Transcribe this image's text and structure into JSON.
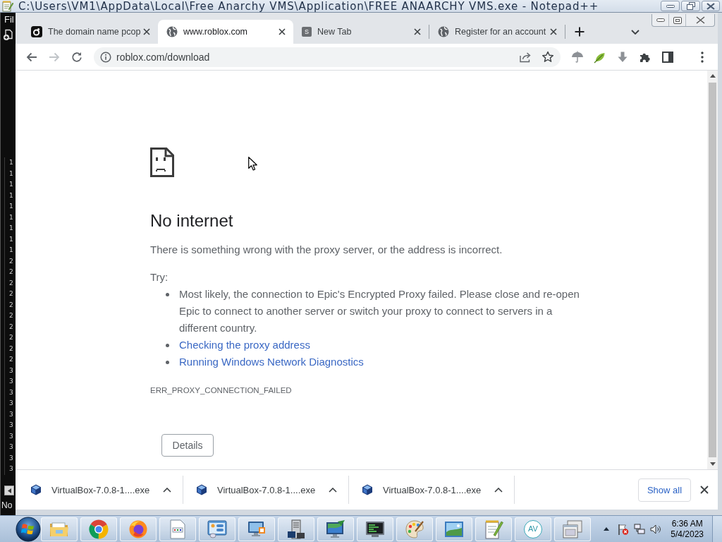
{
  "title_bar": {
    "title": "C:\\Users\\VM1\\AppData\\Local\\Free Anarchy VMS\\Application\\FREE ANAARCHY VMS.exe - Notepad++"
  },
  "editor": {
    "menu_label": "Fil",
    "line_numbers": [
      "1",
      "1",
      "1",
      "1",
      "1",
      "1",
      "1",
      "1",
      "1",
      "2",
      "2",
      "2",
      "2",
      "2",
      "2",
      "2",
      "2",
      "2",
      "2",
      "3",
      "3",
      "3",
      "3",
      "3",
      "3",
      "3",
      "3",
      "3",
      "3"
    ],
    "status_text": "No"
  },
  "browser": {
    "tabs": [
      {
        "title": "The domain name pcop",
        "favicon": {
          "kind": "logo"
        },
        "selected": false
      },
      {
        "title": "www.roblox.com",
        "favicon": {
          "kind": "globe"
        },
        "selected": true
      },
      {
        "title": "New Tab",
        "favicon": {
          "kind": "letter",
          "letter": "S"
        },
        "selected": false
      },
      {
        "title": "Register for an account",
        "favicon": {
          "kind": "globe"
        },
        "selected": false
      }
    ],
    "toolbar": {
      "back": {
        "disabled": false
      },
      "forward": {
        "disabled": true
      },
      "address": "roblox.com/download"
    },
    "page": {
      "heading": "No internet",
      "message": "There is something wrong with the proxy server, or the address is incorrect.",
      "try_label": "Try:",
      "suggestions": [
        {
          "kind": "text",
          "text": "Most likely, the connection to Epic's Encrypted Proxy failed. Please close and re-open Epic to connect to another server or switch your proxy to connect to servers in a different country."
        },
        {
          "kind": "link",
          "text": "Checking the proxy address"
        },
        {
          "kind": "link",
          "text": "Running Windows Network Diagnostics"
        }
      ],
      "error_code": "ERR_PROXY_CONNECTION_FAILED",
      "details_button": "Details"
    },
    "downloads": {
      "items": [
        {
          "filename": "VirtualBox-7.0.8-1....exe"
        },
        {
          "filename": "VirtualBox-7.0.8-1....exe"
        },
        {
          "filename": "VirtualBox-7.0.8-1....exe"
        }
      ],
      "show_all": "Show all"
    }
  },
  "taskbar": {
    "app_badge": "AV",
    "clock": {
      "time": "6:36 AM",
      "date": "5/4/2023"
    }
  }
}
